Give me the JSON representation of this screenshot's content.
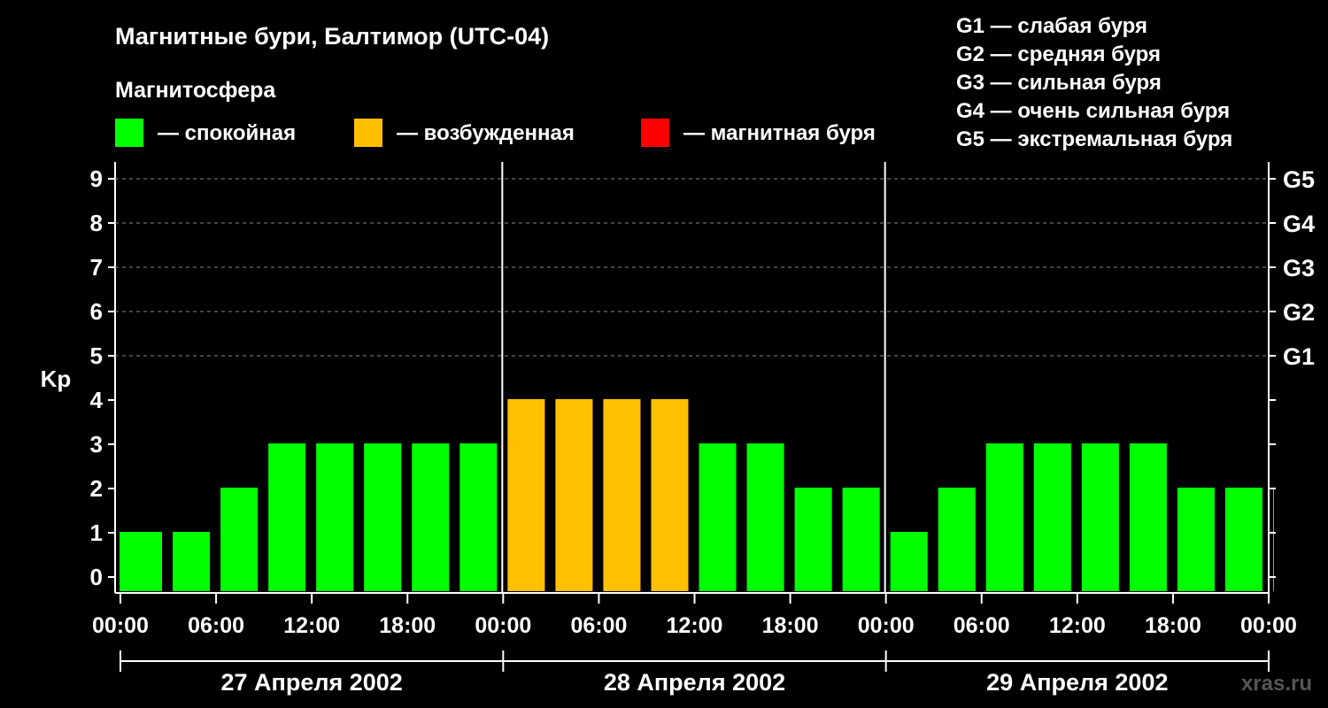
{
  "header": {
    "title": "Магнитные бури, Балтимор (UTC-04)",
    "subtitle": "Магнитосфера"
  },
  "legend": [
    {
      "label": "— спокойная",
      "color": "#00ff00"
    },
    {
      "label": "— возбужденная",
      "color": "#ffc000"
    },
    {
      "label": "— магнитная буря",
      "color": "#ff0000"
    }
  ],
  "scale_legend": [
    "G1 — слабая буря",
    "G2 — средняя буря",
    "G3 — сильная буря",
    "G4 — очень сильная буря",
    "G5 — экстремальная буря"
  ],
  "watermark": "xras.ru",
  "chart_data": {
    "type": "bar",
    "ylabel": "Kp",
    "ylim": [
      0,
      9
    ],
    "y_ticks": [
      "0",
      "1",
      "2",
      "3",
      "4",
      "5",
      "6",
      "7",
      "8",
      "9"
    ],
    "g_ticks": [
      {
        "kp": 5,
        "label": "G1"
      },
      {
        "kp": 6,
        "label": "G2"
      },
      {
        "kp": 7,
        "label": "G3"
      },
      {
        "kp": 8,
        "label": "G4"
      },
      {
        "kp": 9,
        "label": "G5"
      }
    ],
    "x_tick_labels": [
      "00:00",
      "06:00",
      "12:00",
      "18:00",
      "00:00",
      "06:00",
      "12:00",
      "18:00",
      "00:00",
      "06:00",
      "12:00",
      "18:00",
      "00:00"
    ],
    "days": [
      "27 Апреля 2002",
      "28 Апреля 2002",
      "29 Апреля 2002"
    ],
    "bar_interval_hours": 3,
    "values": [
      1,
      1,
      2,
      3,
      3,
      3,
      3,
      3,
      4,
      4,
      4,
      4,
      3,
      3,
      2,
      2,
      1,
      2,
      3,
      3,
      3,
      3,
      2,
      2,
      2
    ],
    "colors": {
      "quiet": "#00ff00",
      "unsettled": "#ffc000",
      "storm": "#ff0000"
    },
    "grid": true
  }
}
